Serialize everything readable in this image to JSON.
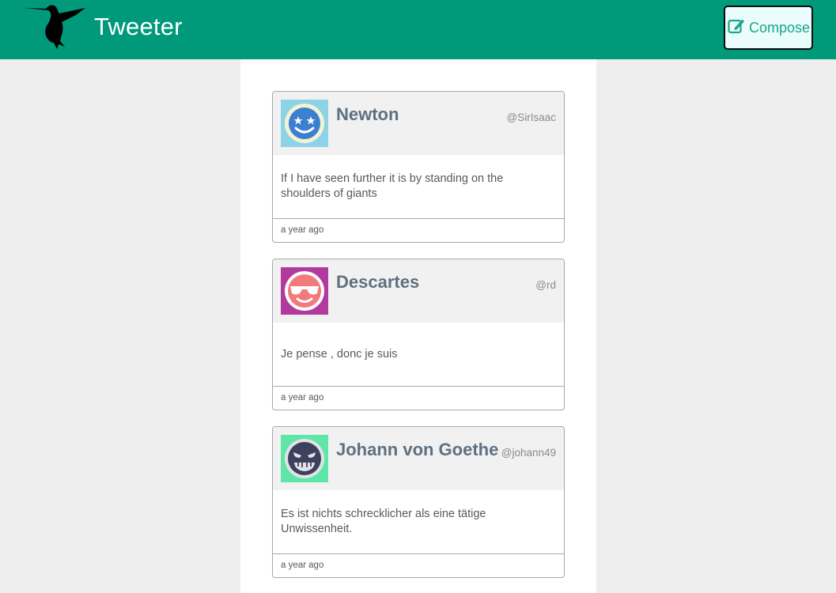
{
  "app": {
    "brand": "Tweeter",
    "logo_icon": "hummingbird-icon",
    "accent": "#00997a"
  },
  "toolbar": {
    "compose_label": "Compose",
    "compose_icon": "edit-icon"
  },
  "tweets": [
    {
      "author": "Newton",
      "handle": "@SirIsaac",
      "content": "If I have seen further it is by standing on the shoulders of giants",
      "time": "a year ago",
      "avatar_icon": "star-eyes-face-icon",
      "avatar_bg": "#8dd3e8"
    },
    {
      "author": "Descartes",
      "handle": "@rd",
      "content": "Je pense , donc je suis",
      "time": "a year ago",
      "avatar_icon": "sunglasses-face-icon",
      "avatar_bg": "#b23a9e"
    },
    {
      "author": "Johann von Goethe",
      "handle": "@johann49",
      "content": "Es ist nichts schrecklicher als eine tätige Unwissenheit.",
      "time": "a year ago",
      "avatar_icon": "grinning-devil-face-icon",
      "avatar_bg": "#5ee6a6"
    }
  ]
}
